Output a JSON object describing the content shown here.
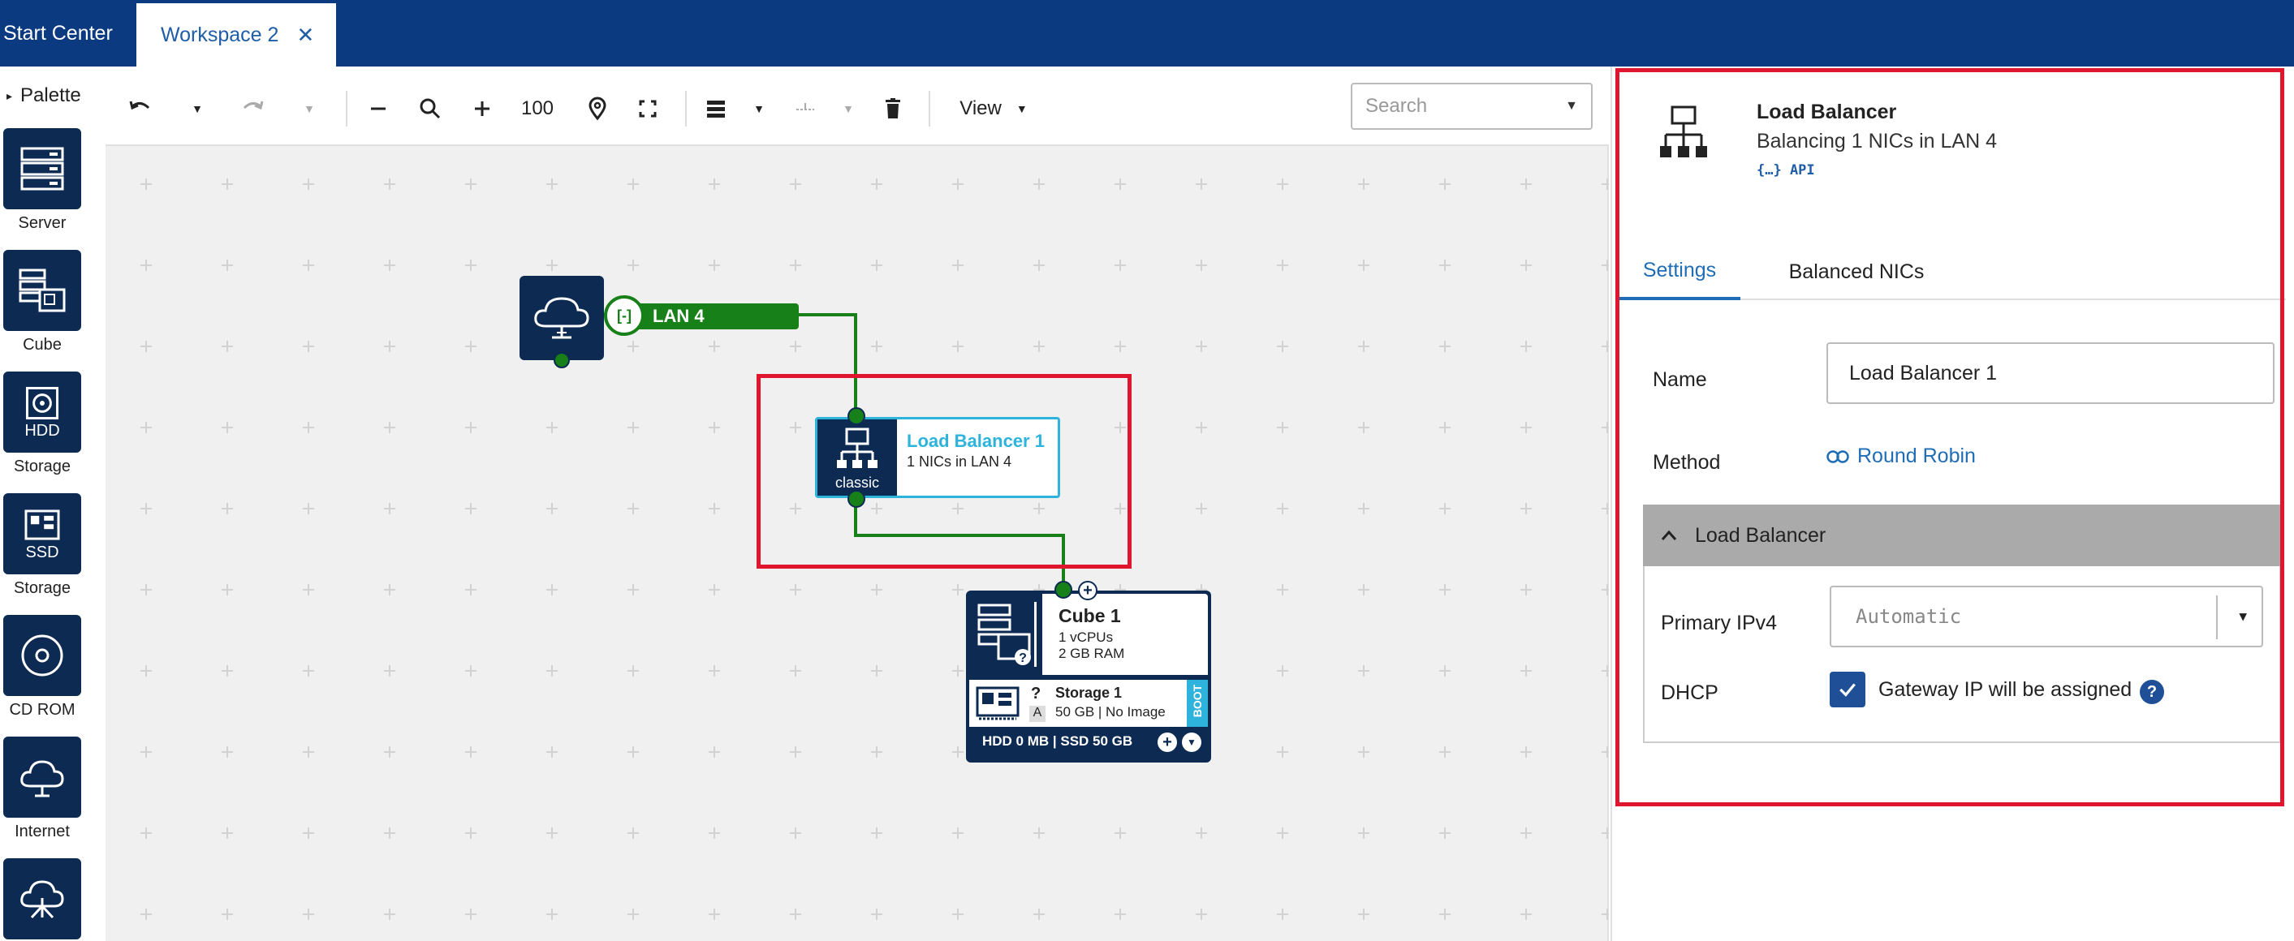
{
  "tabs": {
    "start_center": "Start Center",
    "workspace": "Workspace 2",
    "workspace_close": "✕"
  },
  "palette": {
    "title": "Palette",
    "items": [
      {
        "label": "Server",
        "icon": "server-icon"
      },
      {
        "label": "Cube",
        "icon": "cube-icon"
      },
      {
        "label": "HDD\nStorage",
        "tile_text": "HDD",
        "sub": "Storage",
        "icon": "hdd-icon"
      },
      {
        "label": "SSD\nStorage",
        "tile_text": "SSD",
        "sub": "Storage",
        "icon": "ssd-icon"
      },
      {
        "label": "CD ROM",
        "icon": "cdrom-icon"
      },
      {
        "label": "Internet",
        "icon": "internet-icon"
      },
      {
        "label": "",
        "icon": "network-cloud-icon"
      }
    ]
  },
  "toolbar": {
    "zoom_value": "100",
    "view_label": "View",
    "search_placeholder": "Search"
  },
  "canvas": {
    "lan": {
      "label": "LAN 4",
      "color": "#178018"
    },
    "load_balancer": {
      "title": "Load Balancer 1",
      "subtitle": "1 NICs in LAN 4",
      "badge": "classic",
      "title_color": "#2eb3dc"
    },
    "cube": {
      "title": "Cube 1",
      "cpus": "1 vCPUs",
      "ram": "2 GB RAM",
      "storage_title": "Storage 1",
      "storage_detail": "50 GB | No Image",
      "storage_q": "?",
      "storage_a": "A",
      "boot": "BOOT",
      "footer": "HDD 0 MB | SSD 50 GB"
    }
  },
  "panel": {
    "title": "Load Balancer",
    "subtitle": "Balancing 1 NICs in LAN 4",
    "api": "{…} API",
    "tabs": [
      "Settings",
      "Balanced NICs"
    ],
    "name_label": "Name",
    "name_value": "Load Balancer 1",
    "method_label": "Method",
    "method_value": "Round Robin",
    "section_title": "Load Balancer",
    "primary_ip_label": "Primary IPv4",
    "primary_ip_value": "Automatic",
    "dhcp_label": "DHCP",
    "dhcp_checked": true,
    "dhcp_text": "Gateway IP will be assigned",
    "help": "?"
  },
  "colors": {
    "topbar": "#0b3a80",
    "tile": "#0d2a52",
    "accent": "#1f6db5",
    "highlight": "#e0152e",
    "network_green": "#178018"
  }
}
